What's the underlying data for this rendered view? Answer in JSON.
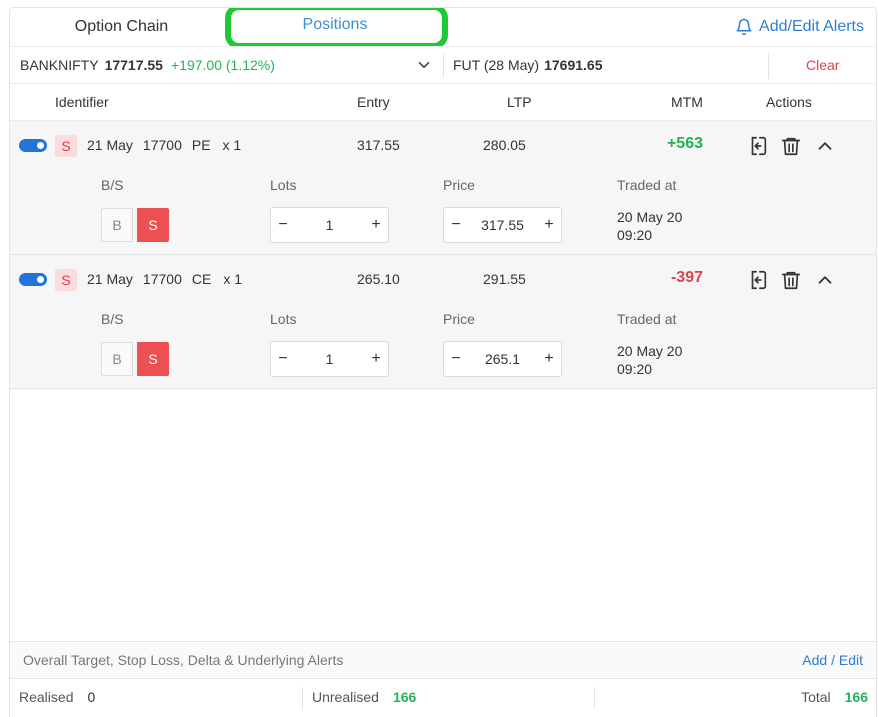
{
  "tabs": {
    "option_chain": "Option Chain",
    "positions": "Positions",
    "add_edit_alerts": "Add/Edit Alerts"
  },
  "underlying": {
    "symbol": "BANKNIFTY",
    "price": "17717.55",
    "change": "+197.00 (1.12%)",
    "fut_label": "FUT (28 May)",
    "fut_price": "17691.65",
    "clear": "Clear"
  },
  "columns": {
    "identifier": "Identifier",
    "entry": "Entry",
    "ltp": "LTP",
    "mtm": "MTM",
    "actions": "Actions"
  },
  "sub_labels": {
    "bs": "B/S",
    "lots": "Lots",
    "price": "Price",
    "traded_at": "Traded at"
  },
  "positions": [
    {
      "side": "S",
      "expiry": "21 May",
      "strike": "17700",
      "type": "PE",
      "qty": "x 1",
      "entry": "317.55",
      "ltp": "280.05",
      "mtm": "+563",
      "buy_label": "B",
      "sell_label": "S",
      "lots": "1",
      "price": "317.55",
      "traded_date": "20 May 20",
      "traded_time": "09:20",
      "enabled": true
    },
    {
      "side": "S",
      "expiry": "21 May",
      "strike": "17700",
      "type": "CE",
      "qty": "x 1",
      "entry": "265.10",
      "ltp": "291.55",
      "mtm": "-397",
      "buy_label": "B",
      "sell_label": "S",
      "lots": "1",
      "price": "265.1",
      "traded_date": "20 May 20",
      "traded_time": "09:20",
      "enabled": true
    }
  ],
  "footer": {
    "alerts_text": "Overall Target, Stop Loss, Delta & Underlying Alerts",
    "alerts_link": "Add / Edit",
    "realised_label": "Realised",
    "realised_value": "0",
    "unrealised_label": "Unrealised",
    "unrealised_value": "166",
    "total_label": "Total",
    "total_value": "166"
  },
  "stepper": {
    "minus": "−",
    "plus": "+"
  },
  "colors": {
    "accent": "#2a7fd4",
    "profit": "#22b357",
    "loss": "#e0414a",
    "sell": "#ec5052",
    "highlight": "#1ec935"
  }
}
